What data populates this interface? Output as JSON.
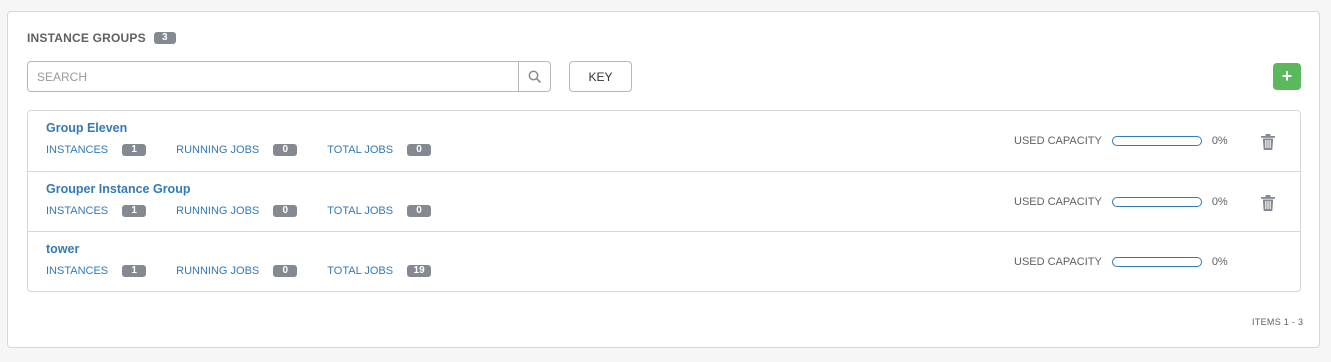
{
  "panel": {
    "title": "INSTANCE GROUPS",
    "count": "3"
  },
  "toolbar": {
    "search_placeholder": "SEARCH",
    "search_value": "",
    "key_label": "KEY",
    "add_label": "+"
  },
  "rows": [
    {
      "name": "Group Eleven",
      "instances_label": "INSTANCES",
      "instances": "1",
      "running_label": "RUNNING JOBS",
      "running": "0",
      "total_label": "TOTAL JOBS",
      "total": "0",
      "capacity_label": "USED CAPACITY",
      "capacity_pct": "0%",
      "capacity_fraction": 0,
      "deletable": true
    },
    {
      "name": "Grouper Instance Group",
      "instances_label": "INSTANCES",
      "instances": "1",
      "running_label": "RUNNING JOBS",
      "running": "0",
      "total_label": "TOTAL JOBS",
      "total": "0",
      "capacity_label": "USED CAPACITY",
      "capacity_pct": "0%",
      "capacity_fraction": 0,
      "deletable": true
    },
    {
      "name": "tower",
      "instances_label": "INSTANCES",
      "instances": "1",
      "running_label": "RUNNING JOBS",
      "running": "0",
      "total_label": "TOTAL JOBS",
      "total": "19",
      "capacity_label": "USED CAPACITY",
      "capacity_pct": "0%",
      "capacity_fraction": 0,
      "deletable": false
    }
  ],
  "pagination": {
    "items_text": "ITEMS  1 - 3"
  },
  "colors": {
    "accent": "#337ab7",
    "add": "#5cb85c",
    "badge": "#848992"
  },
  "icons": {
    "search": "search-icon",
    "delete": "trash-icon",
    "add": "plus-icon"
  }
}
